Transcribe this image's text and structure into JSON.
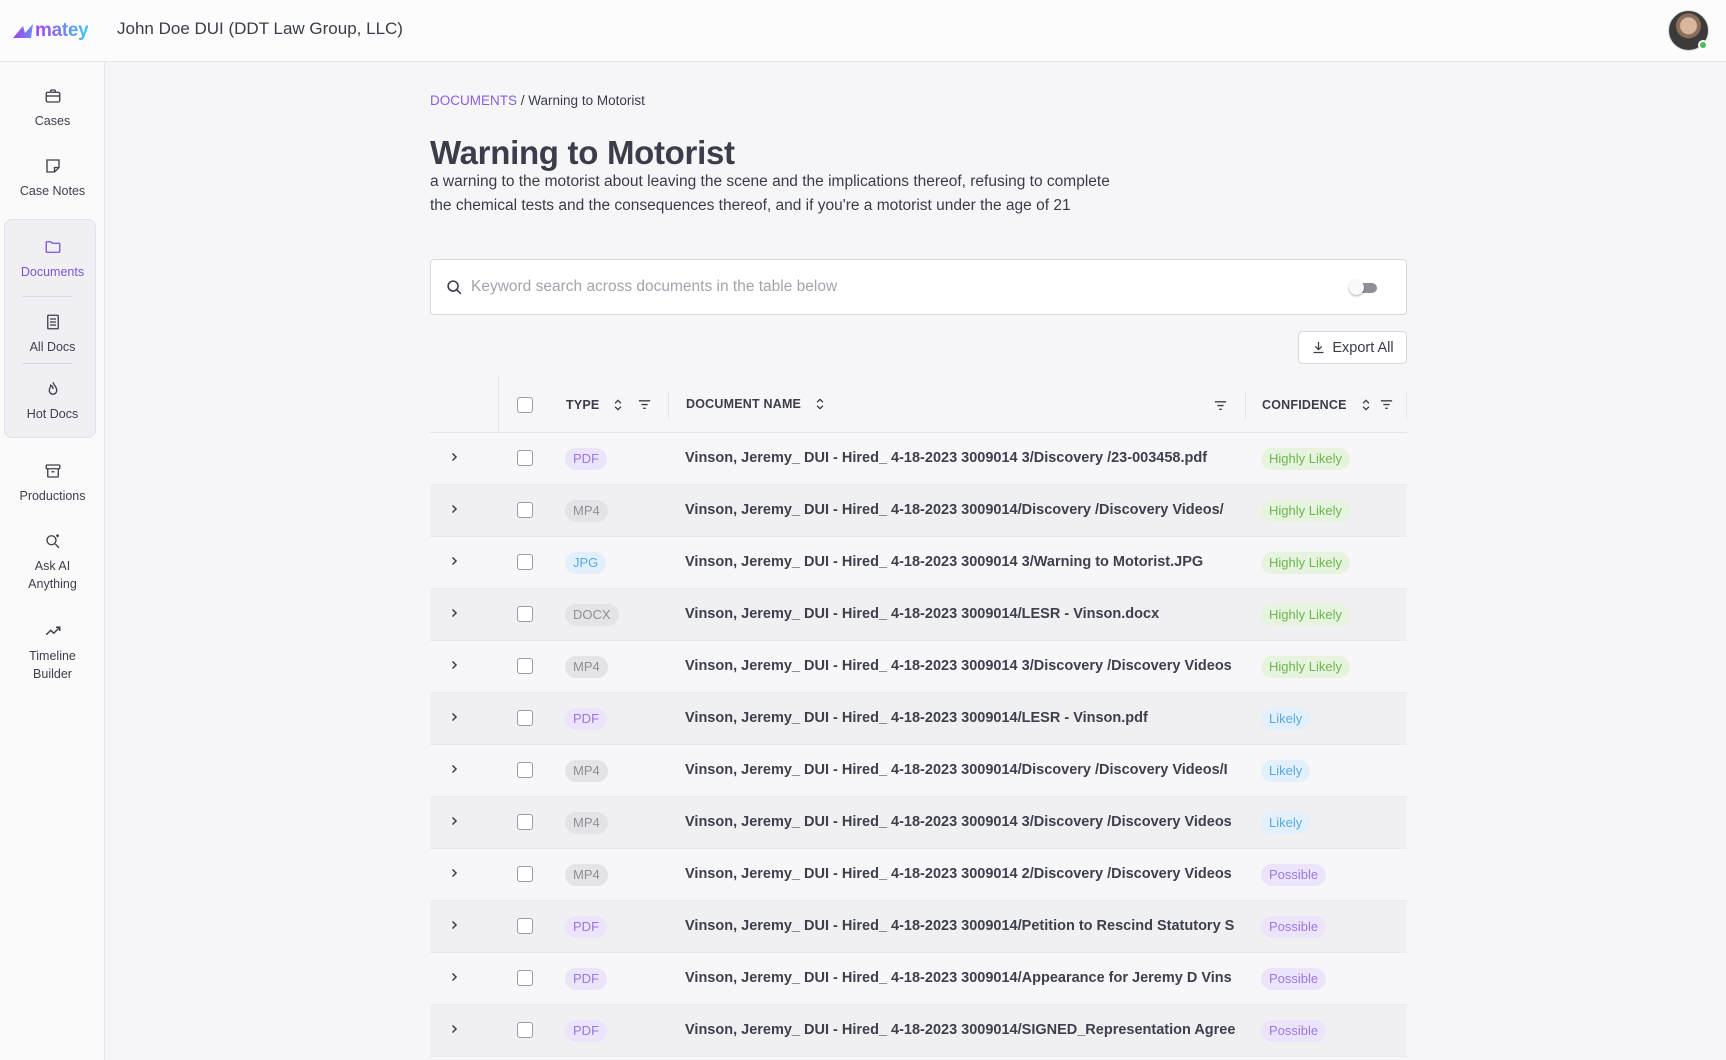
{
  "app": {
    "logo_text": "matey",
    "case_title": "John Doe DUI (DDT Law Group, LLC)"
  },
  "sidebar": {
    "items": [
      {
        "label": "Cases",
        "icon": "briefcase-icon"
      },
      {
        "label": "Case Notes",
        "icon": "sticky-note-icon"
      },
      {
        "label": "Documents",
        "icon": "folder-icon",
        "active": true
      },
      {
        "label": "All Docs",
        "icon": "document-list-icon"
      },
      {
        "label": "Hot Docs",
        "icon": "flame-icon"
      },
      {
        "label": "Productions",
        "icon": "archive-box-icon"
      },
      {
        "label": "Ask AI Anything",
        "icon": "ai-search-icon"
      },
      {
        "label": "Timeline Builder",
        "icon": "trend-line-icon"
      }
    ]
  },
  "breadcrumb": {
    "root": "DOCUMENTS",
    "separator": "/",
    "current": "Warning to Motorist"
  },
  "page": {
    "title": "Warning to Motorist",
    "description": "a warning to the motorist about leaving the scene and the implications thereof, refusing to complete the chemical tests and the consequences thereof, and if you're a motorist under the age of 21"
  },
  "search": {
    "placeholder": "Keyword search across documents in the table below",
    "value": "",
    "toggle_on": false
  },
  "toolbar": {
    "export_label": "Export All"
  },
  "table": {
    "headers": {
      "type": "TYPE",
      "name": "DOCUMENT NAME",
      "confidence": "CONFIDENCE"
    },
    "rows": [
      {
        "type": "PDF",
        "name": "Vinson, Jeremy_ DUI - Hired_ 4-18-2023 3009014 3/Discovery /23-003458.pdf",
        "confidence": "Highly Likely"
      },
      {
        "type": "MP4",
        "name": "Vinson, Jeremy_ DUI - Hired_ 4-18-2023 3009014/Discovery /Discovery Videos/",
        "confidence": "Highly Likely"
      },
      {
        "type": "JPG",
        "name": "Vinson, Jeremy_ DUI - Hired_ 4-18-2023 3009014 3/Warning to Motorist.JPG",
        "confidence": "Highly Likely"
      },
      {
        "type": "DOCX",
        "name": "Vinson, Jeremy_ DUI - Hired_ 4-18-2023 3009014/LESR - Vinson.docx",
        "confidence": "Highly Likely"
      },
      {
        "type": "MP4",
        "name": "Vinson, Jeremy_ DUI - Hired_ 4-18-2023 3009014 3/Discovery /Discovery Videos",
        "confidence": "Highly Likely"
      },
      {
        "type": "PDF",
        "name": "Vinson, Jeremy_ DUI - Hired_ 4-18-2023 3009014/LESR - Vinson.pdf",
        "confidence": "Likely"
      },
      {
        "type": "MP4",
        "name": "Vinson, Jeremy_ DUI - Hired_ 4-18-2023 3009014/Discovery /Discovery Videos/I",
        "confidence": "Likely"
      },
      {
        "type": "MP4",
        "name": "Vinson, Jeremy_ DUI - Hired_ 4-18-2023 3009014 3/Discovery /Discovery Videos",
        "confidence": "Likely"
      },
      {
        "type": "MP4",
        "name": "Vinson, Jeremy_ DUI - Hired_ 4-18-2023 3009014 2/Discovery /Discovery Videos",
        "confidence": "Possible"
      },
      {
        "type": "PDF",
        "name": "Vinson, Jeremy_ DUI - Hired_ 4-18-2023 3009014/Petition to Rescind Statutory S",
        "confidence": "Possible"
      },
      {
        "type": "PDF",
        "name": "Vinson, Jeremy_ DUI - Hired_ 4-18-2023 3009014/Appearance for Jeremy D Vins",
        "confidence": "Possible"
      },
      {
        "type": "PDF",
        "name": "Vinson, Jeremy_ DUI - Hired_ 4-18-2023 3009014/SIGNED_Representation Agree",
        "confidence": "Possible"
      }
    ]
  },
  "colors": {
    "accent": "#8a5fe0",
    "highly_likely": "#6cb64d",
    "likely": "#5aa9e3",
    "possible": "#9b79e3"
  }
}
